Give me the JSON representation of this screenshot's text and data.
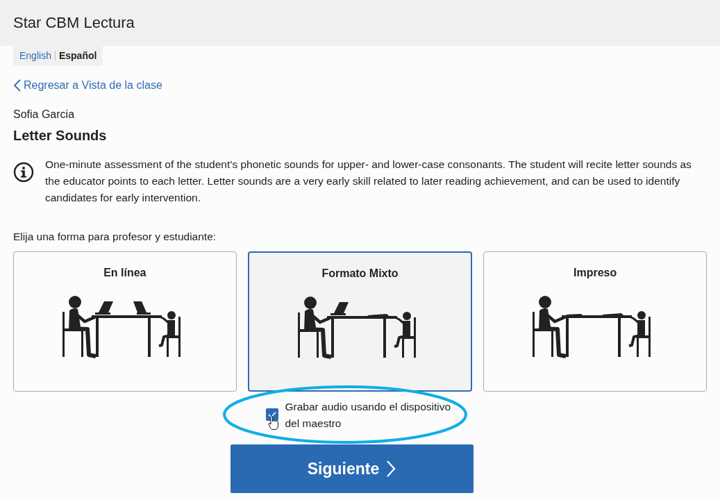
{
  "app_title": "Star CBM Lectura",
  "languages": [
    {
      "label": "English",
      "selected": false
    },
    {
      "label": "Español",
      "selected": true
    }
  ],
  "back_link": "Regresar a Vista de la clase",
  "student_name": "Sofia Garcia",
  "assessment_title": "Letter Sounds",
  "description": "One-minute assessment of the student’s phonetic sounds for upper- and lower-case consonants. The student will recite letter sounds as the educator points to each letter. Letter sounds are a very early skill related to later reading achievement, and can be used to identify candidates for early intervention.",
  "prompt": "Elija una forma para profesor y estudiante:",
  "forms": [
    {
      "label": "En línea",
      "kind": "online",
      "selected": false
    },
    {
      "label": "Formato Mixto",
      "kind": "mixed",
      "selected": true
    },
    {
      "label": "Impreso",
      "kind": "print",
      "selected": false
    }
  ],
  "record_audio": {
    "label": "Grabar audio usando el dispositivo del maestro",
    "checked": true
  },
  "next_button": "Siguiente"
}
